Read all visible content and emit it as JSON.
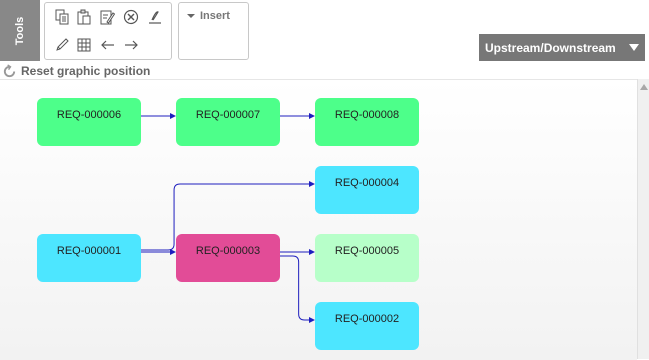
{
  "sidebar_tab": {
    "label": "Tools"
  },
  "toolbar": {
    "tools": [
      {
        "icon": "copy-icon"
      },
      {
        "icon": "paste-icon"
      },
      {
        "icon": "edit-icon"
      },
      {
        "icon": "delete-icon"
      },
      {
        "icon": "signature-icon"
      },
      {
        "icon": "pencil-icon"
      },
      {
        "icon": "table-icon"
      },
      {
        "icon": "arrow-left-icon"
      },
      {
        "icon": "arrow-right-icon"
      }
    ],
    "insert_label": "Insert"
  },
  "view_selector": {
    "value": "Upstream/Downstream"
  },
  "reset_link": {
    "label": "Reset graphic position"
  },
  "diagram": {
    "link_color": "#1e1ebe",
    "nodes": [
      {
        "id": "REQ-000006",
        "color": "#4dff8a"
      },
      {
        "id": "REQ-000007",
        "color": "#4dff8a"
      },
      {
        "id": "REQ-000008",
        "color": "#4dff8a"
      },
      {
        "id": "REQ-000004",
        "color": "#4de6ff"
      },
      {
        "id": "REQ-000001",
        "color": "#4de6ff"
      },
      {
        "id": "REQ-000003",
        "color": "#e24c97"
      },
      {
        "id": "REQ-000005",
        "color": "#b7ffc9"
      },
      {
        "id": "REQ-000002",
        "color": "#4de6ff"
      }
    ],
    "links": [
      {
        "from": "REQ-000006",
        "to": "REQ-000007"
      },
      {
        "from": "REQ-000007",
        "to": "REQ-000008"
      },
      {
        "from": "REQ-000001",
        "to": "REQ-000004"
      },
      {
        "from": "REQ-000001",
        "to": "REQ-000003"
      },
      {
        "from": "REQ-000003",
        "to": "REQ-000005"
      },
      {
        "from": "REQ-000003",
        "to": "REQ-000002"
      }
    ]
  }
}
